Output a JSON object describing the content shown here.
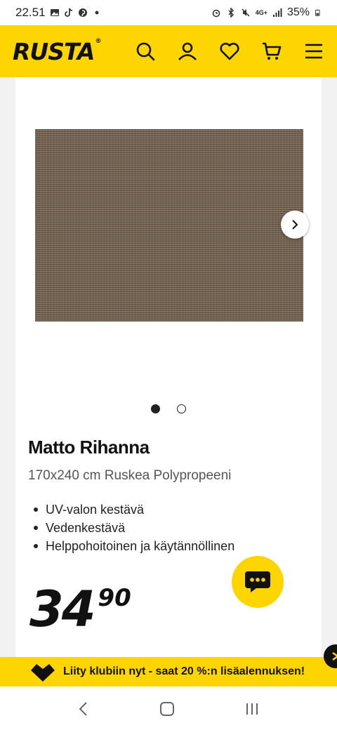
{
  "status_bar": {
    "time": "22.51",
    "battery": "35%",
    "network": "4G+",
    "icons": [
      "gallery-icon",
      "tiktok-icon",
      "pinterest-icon",
      "dot-icon",
      "alarm-icon",
      "bluetooth-icon",
      "mute-icon",
      "signal-icon",
      "battery-icon"
    ]
  },
  "header": {
    "logo": "RUSTA",
    "logo_mark": "®",
    "icons": [
      "search-icon",
      "account-icon",
      "heart-icon",
      "cart-icon",
      "menu-icon"
    ]
  },
  "product": {
    "image": {
      "description_icon": "rug-image",
      "carousel_count": 2,
      "active_slide": 1
    },
    "title": "Matto Rihanna",
    "subtitle": "170x240 cm Ruskea Polypropeeni",
    "features": [
      "UV-valon kestävä",
      "Vedenkestävä",
      "Helppohoitoinen ja käytännöllinen"
    ],
    "price": {
      "main": "34",
      "decimals": "90"
    }
  },
  "promo": {
    "text": "Liity klubiin nyt - saat 20 %:n lisäalennuksen!"
  },
  "colors": {
    "brand_yellow": "#ffd500",
    "text_dark": "#111111",
    "rug_brown": "#7b6a57"
  },
  "navbar": {
    "icons": [
      "back-icon",
      "home-icon",
      "recents-icon"
    ]
  }
}
